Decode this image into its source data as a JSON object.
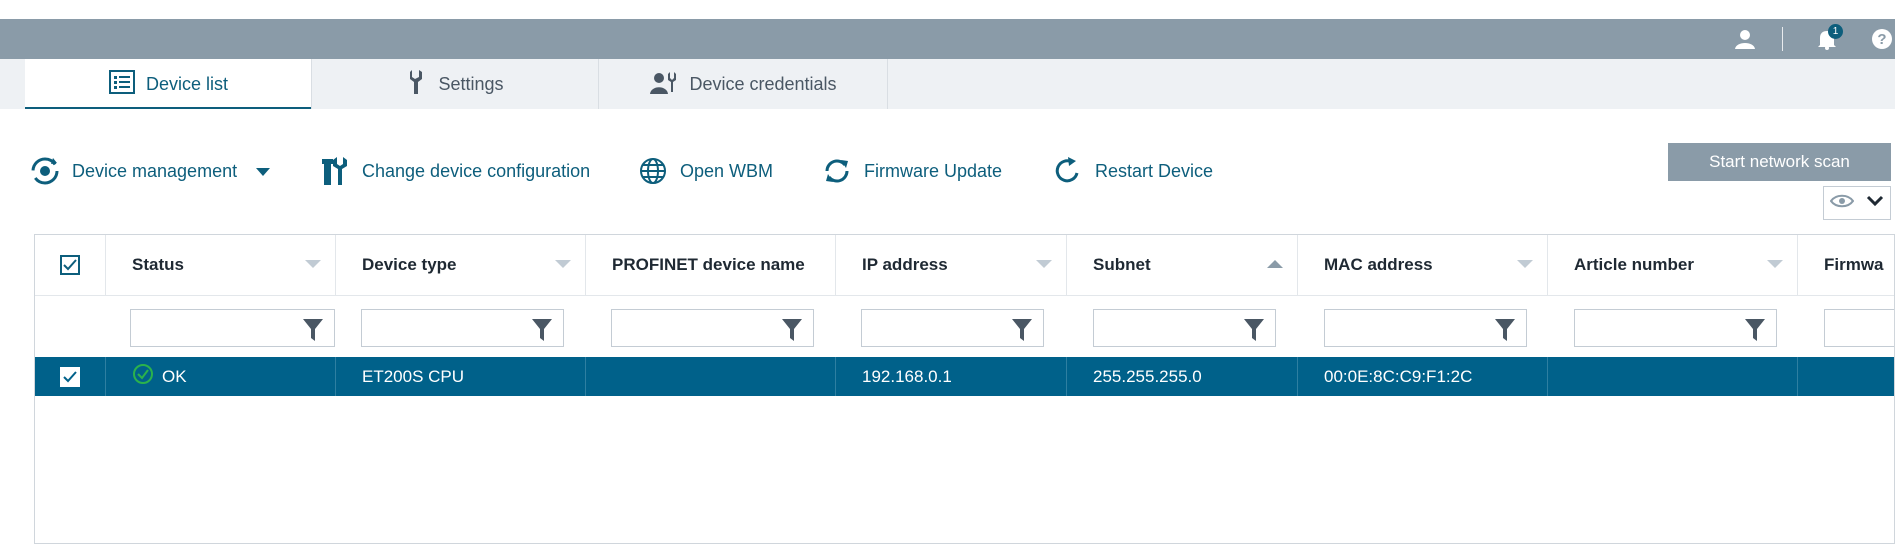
{
  "topbar": {
    "icons": [
      "user-icon",
      "bell-icon",
      "help-icon"
    ],
    "notification_count": "1",
    "help_glyph": "?"
  },
  "tabs": [
    {
      "label": "Device list",
      "icon": "list-icon",
      "active": true
    },
    {
      "label": "Settings",
      "icon": "wrench-icon",
      "active": false
    },
    {
      "label": "Device credentials",
      "icon": "user-key-icon",
      "active": false
    }
  ],
  "toolbar": {
    "device_management": "Device management",
    "change_config": "Change device configuration",
    "open_wbm": "Open WBM",
    "firmware_update": "Firmware Update",
    "restart_device": "Restart Device",
    "start_scan": "Start network scan"
  },
  "table": {
    "columns": [
      "Status",
      "Device type",
      "PROFINET device name",
      "IP address",
      "Subnet",
      "MAC address",
      "Article number",
      "Firmwa"
    ],
    "sorted_column": "Subnet",
    "rows": [
      {
        "selected": true,
        "status": "OK",
        "device_type": "ET200S CPU",
        "profinet_name": "",
        "ip": "192.168.0.1",
        "subnet": "255.255.255.0",
        "mac": "00:0E:8C:C9:F1:2C",
        "article": "",
        "firmware": ""
      }
    ]
  },
  "colors": {
    "accent": "#0d5e7c",
    "header_bar": "#8a9ba8",
    "selected_row": "#00618a",
    "ok": "#2bb24c"
  }
}
